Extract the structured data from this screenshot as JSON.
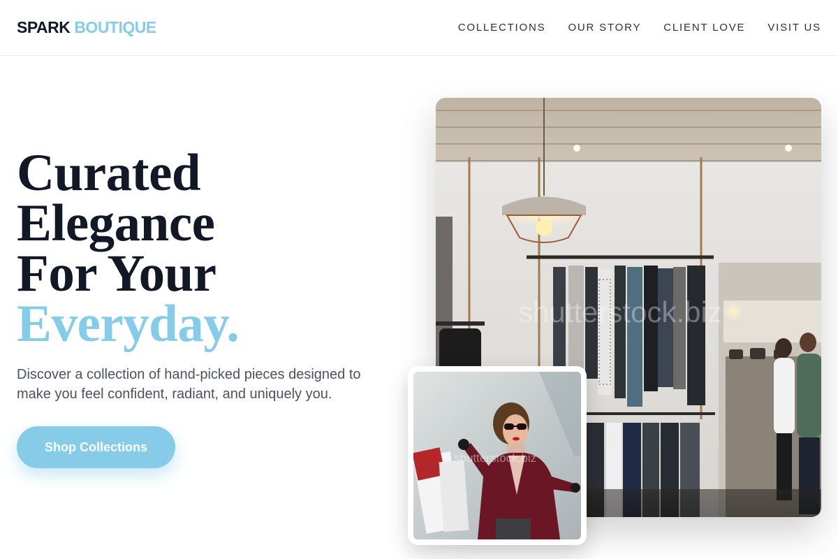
{
  "header": {
    "logo_primary": "SPARK",
    "logo_secondary": "BOUTIQUE",
    "nav": [
      {
        "label": "COLLECTIONS"
      },
      {
        "label": "OUR STORY"
      },
      {
        "label": "CLIENT LOVE"
      },
      {
        "label": "VISIT US"
      }
    ]
  },
  "hero": {
    "headline_lines": [
      "Curated",
      "Elegance",
      "For Your"
    ],
    "headline_accent": "Everyday.",
    "subtitle": "Discover a collection of hand-picked pieces designed to make you feel confident, radiant, and uniquely you.",
    "cta_label": "Shop Collections"
  },
  "images": {
    "main_alt": "Boutique interior with hanging clothing racks and pendant lamps",
    "main_watermark": "shutterstock.biz",
    "inset_alt": "Woman in red coat and sunglasses holding shopping bags",
    "inset_watermark": "shutterstock.biz"
  },
  "colors": {
    "accent": "#86cbe8",
    "ink": "#121826",
    "body_text": "#4a5260"
  }
}
